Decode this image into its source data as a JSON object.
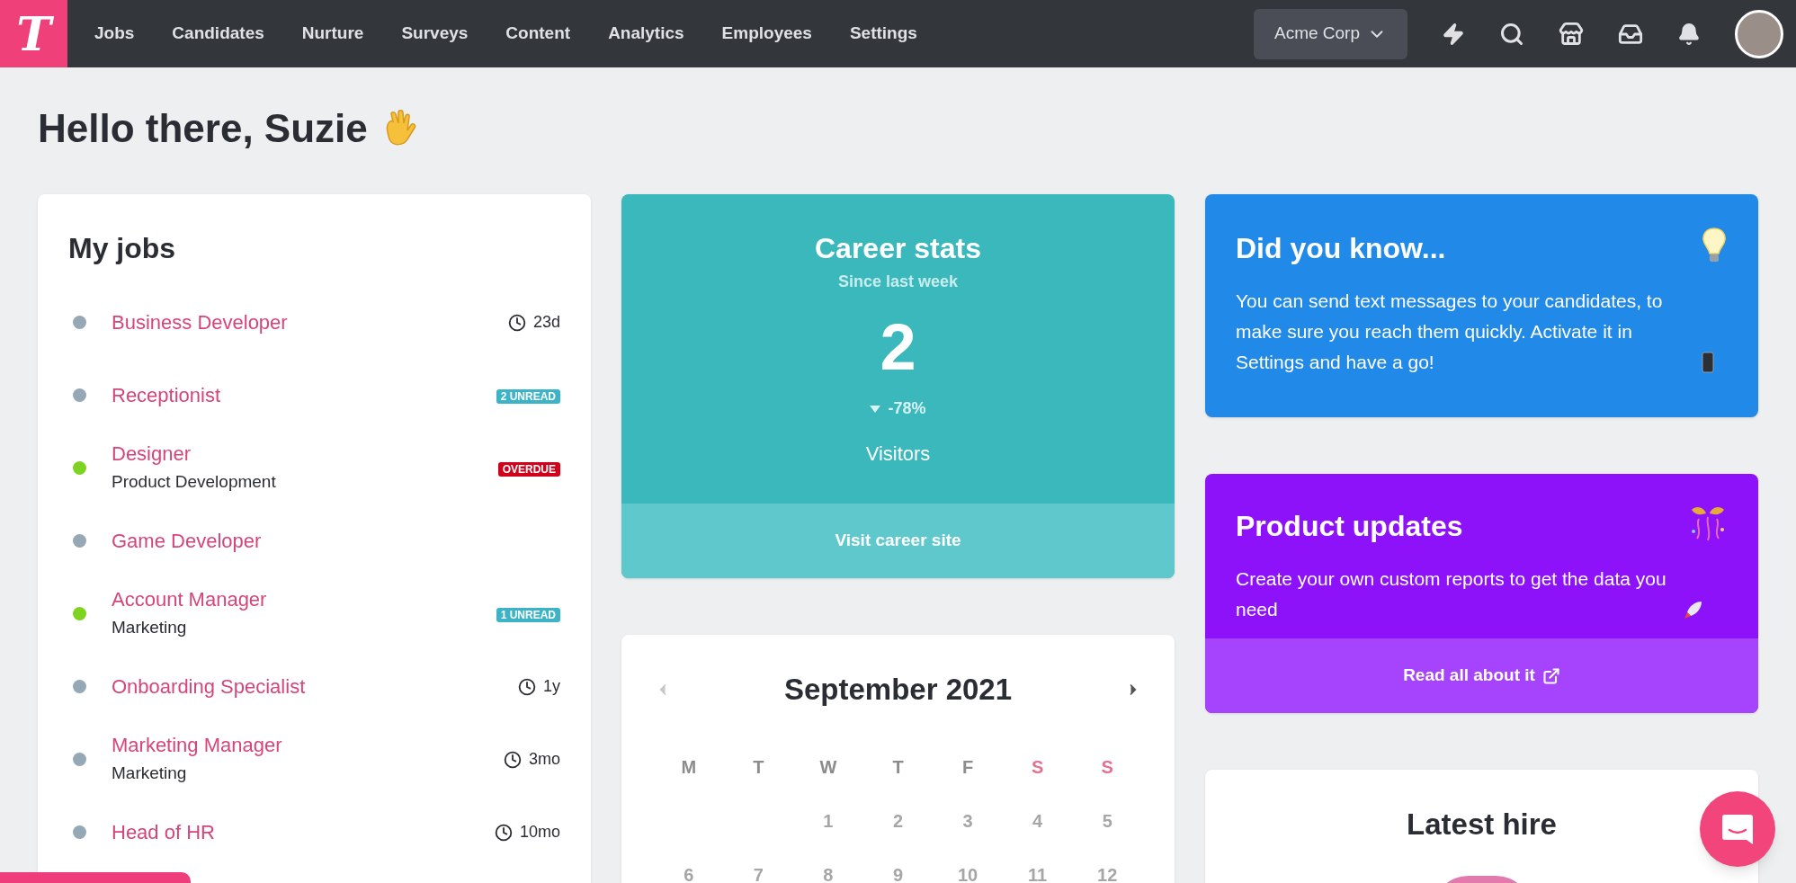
{
  "nav": {
    "logo": "T",
    "items": [
      {
        "label": "Jobs"
      },
      {
        "label": "Candidates"
      },
      {
        "label": "Nurture"
      },
      {
        "label": "Surveys"
      },
      {
        "label": "Content"
      },
      {
        "label": "Analytics"
      },
      {
        "label": "Employees"
      },
      {
        "label": "Settings"
      }
    ],
    "company": "Acme Corp"
  },
  "greeting": "Hello there, Suzie",
  "my_jobs": {
    "title": "My jobs",
    "items": [
      {
        "title": "Business Developer",
        "color": "#94a8b5",
        "meta": {
          "kind": "time",
          "text": "23d"
        }
      },
      {
        "title": "Receptionist",
        "color": "#94a8b5",
        "meta": {
          "kind": "unread",
          "text": "2 UNREAD"
        }
      },
      {
        "title": "Designer",
        "subtitle": "Product Development",
        "color": "#7ed321",
        "meta": {
          "kind": "overdue",
          "text": "OVERDUE"
        }
      },
      {
        "title": "Game Developer",
        "color": "#94a8b5"
      },
      {
        "title": "Account Manager",
        "subtitle": "Marketing",
        "color": "#7ed321",
        "meta": {
          "kind": "unread",
          "text": "1 UNREAD"
        }
      },
      {
        "title": "Onboarding Specialist",
        "color": "#94a8b5",
        "meta": {
          "kind": "time",
          "text": "1y"
        }
      },
      {
        "title": "Marketing Manager",
        "subtitle": "Marketing",
        "color": "#94a8b5",
        "meta": {
          "kind": "time",
          "text": "3mo"
        }
      },
      {
        "title": "Head of HR",
        "color": "#94a8b5",
        "meta": {
          "kind": "time",
          "text": "10mo"
        }
      }
    ]
  },
  "career_stats": {
    "title": "Career stats",
    "subtitle": "Since last week",
    "value": "2",
    "delta": {
      "text": "-78%"
    },
    "label": "Visitors",
    "link": "Visit career site"
  },
  "calendar": {
    "title": "September 2021",
    "weekdays": [
      {
        "label": "M",
        "weekend": false
      },
      {
        "label": "T",
        "weekend": false
      },
      {
        "label": "W",
        "weekend": false
      },
      {
        "label": "T",
        "weekend": false
      },
      {
        "label": "F",
        "weekend": false
      },
      {
        "label": "S",
        "weekend": true
      },
      {
        "label": "S",
        "weekend": true
      }
    ],
    "weeks": [
      [
        "1",
        "2",
        "3",
        "4",
        "5"
      ],
      [
        "6",
        "7",
        "8",
        "9",
        "10",
        "11",
        "12"
      ]
    ]
  },
  "did_you_know": {
    "title": "Did you know...",
    "text": "You can send text messages to your candidates, to make sure you reach them quickly. Activate it in Settings and have a go!"
  },
  "product_updates": {
    "title": "Product updates",
    "text": "Create your own custom reports to get the data you need",
    "link": "Read all about it"
  },
  "latest_hire": {
    "title": "Latest hire"
  }
}
